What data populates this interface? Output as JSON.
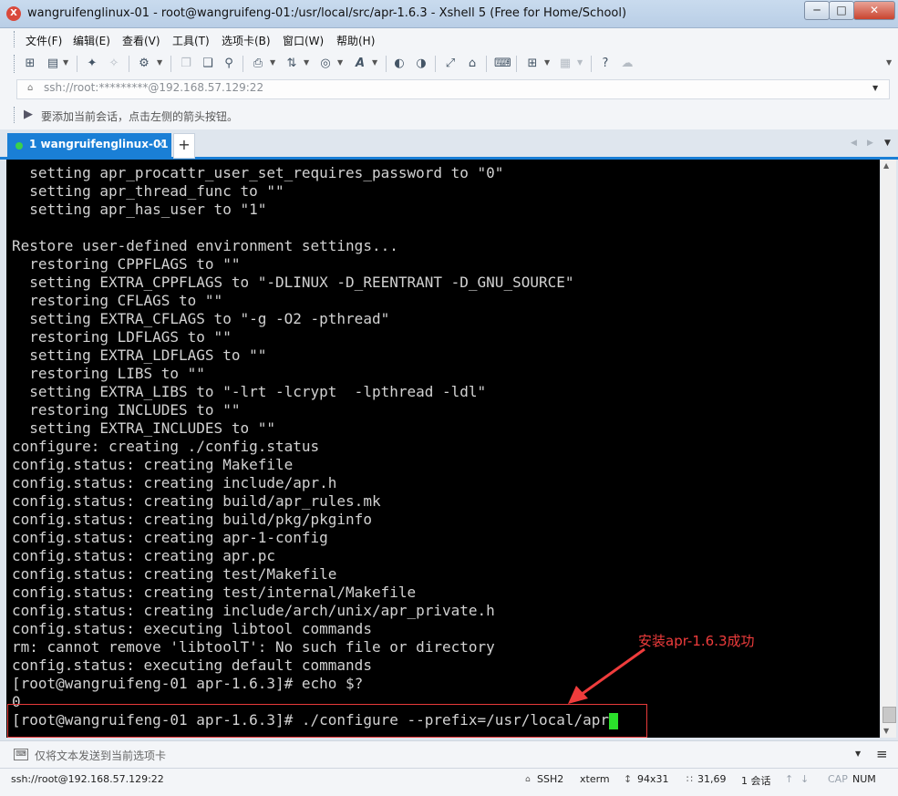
{
  "window": {
    "title": "wangruifenglinux-01 - root@wangruifeng-01:/usr/local/src/apr-1.6.3 - Xshell 5 (Free for Home/School)",
    "minimize": "─",
    "maximize": "□",
    "close": "✕"
  },
  "menu": [
    "文件(F)",
    "编辑(E)",
    "查看(V)",
    "工具(T)",
    "选项卡(B)",
    "窗口(W)",
    "帮助(H)"
  ],
  "toolbar_icons": [
    "new-session-icon",
    "open-folder-icon",
    "reconnect-icon",
    "disconnect-icon",
    "properties-icon",
    "copy-icon",
    "paste-icon",
    "find-icon",
    "print-icon",
    "transfer-icon",
    "globe-icon",
    "font-icon",
    "xftp-icon",
    "xmanager-icon",
    "fullscreen-icon",
    "lock-icon",
    "keyboard-icon",
    "new-tab-icon",
    "layout-icon",
    "help-icon",
    "chat-icon"
  ],
  "address": {
    "text": "ssh://root:*********@192.168.57.129:22"
  },
  "hint": "要添加当前会话，点击左侧的箭头按钮。",
  "tabs": [
    {
      "label": "1 wangruifenglinux-01",
      "close": "×"
    }
  ],
  "terminal": {
    "lines": [
      "  setting apr_procattr_user_set_requires_password to \"0\"",
      "  setting apr_thread_func to \"\"",
      "  setting apr_has_user to \"1\"",
      "",
      "Restore user-defined environment settings...",
      "  restoring CPPFLAGS to \"\"",
      "  setting EXTRA_CPPFLAGS to \"-DLINUX -D_REENTRANT -D_GNU_SOURCE\"",
      "  restoring CFLAGS to \"\"",
      "  setting EXTRA_CFLAGS to \"-g -O2 -pthread\"",
      "  restoring LDFLAGS to \"\"",
      "  setting EXTRA_LDFLAGS to \"\"",
      "  restoring LIBS to \"\"",
      "  setting EXTRA_LIBS to \"-lrt -lcrypt  -lpthread -ldl\"",
      "  restoring INCLUDES to \"\"",
      "  setting EXTRA_INCLUDES to \"\"",
      "configure: creating ./config.status",
      "config.status: creating Makefile",
      "config.status: creating include/apr.h",
      "config.status: creating build/apr_rules.mk",
      "config.status: creating build/pkg/pkginfo",
      "config.status: creating apr-1-config",
      "config.status: creating apr.pc",
      "config.status: creating test/Makefile",
      "config.status: creating test/internal/Makefile",
      "config.status: creating include/arch/unix/apr_private.h",
      "config.status: executing libtool commands",
      "rm: cannot remove 'libtoolT': No such file or directory",
      "config.status: executing default commands",
      "[root@wangruifeng-01 apr-1.6.3]# echo $?",
      "0"
    ],
    "prompt_line": "[root@wangruifeng-01 apr-1.6.3]# ./configure --prefix=/usr/local/apr"
  },
  "annotation": {
    "text": "安装apr-1.6.3成功",
    "color": "#ef3c3c"
  },
  "send_bar": {
    "text": "仅将文本发送到当前选项卡"
  },
  "status": {
    "connection": "ssh://root@192.168.57.129:22",
    "protocol": "SSH2",
    "terminal_type": "xterm",
    "size": "94x31",
    "cursor": "31,69",
    "sessions": "1 会话",
    "cap": "CAP",
    "num": "NUM"
  },
  "colors": {
    "accent": "#1a7fd6",
    "terminal_bg": "#000000",
    "terminal_fg": "#d2d2d2",
    "cursor": "#2be02b",
    "annotation": "#ef3c3c"
  }
}
